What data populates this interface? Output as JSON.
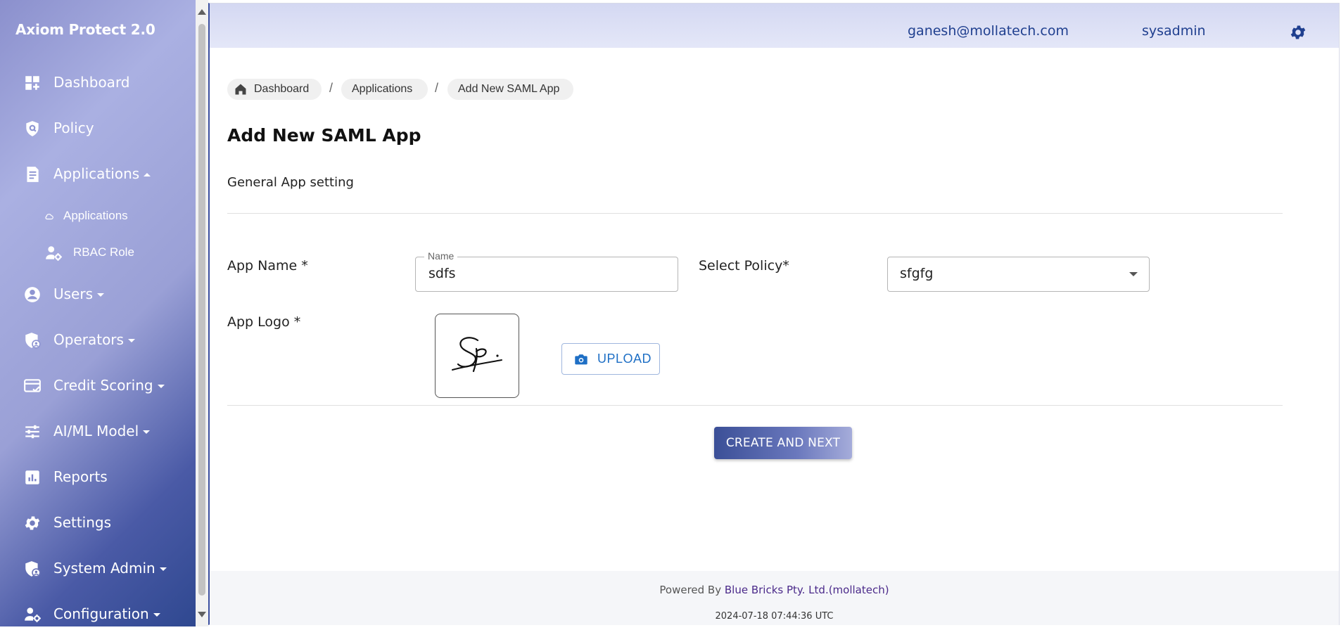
{
  "app": {
    "brand": "Axiom Protect 2.0"
  },
  "sidebar": {
    "items": [
      {
        "label": "Dashboard",
        "icon": "dashboard-icon"
      },
      {
        "label": "Policy",
        "icon": "shield-search-icon"
      },
      {
        "label": "Applications",
        "icon": "document-icon",
        "expanded": true
      },
      {
        "label": "Users",
        "icon": "user-circle-icon"
      },
      {
        "label": "Operators",
        "icon": "shield-person-icon"
      },
      {
        "label": "Credit Scoring",
        "icon": "card-check-icon"
      },
      {
        "label": "AI/ML Model",
        "icon": "sliders-icon"
      },
      {
        "label": "Reports",
        "icon": "bar-chart-icon"
      },
      {
        "label": "Settings",
        "icon": "gear-icon"
      },
      {
        "label": "System Admin",
        "icon": "shield-lock-icon"
      },
      {
        "label": "Configuration",
        "icon": "user-gear-icon"
      }
    ],
    "subitems": [
      {
        "label": "Applications",
        "icon": "cloud-icon"
      },
      {
        "label": "RBAC Role",
        "icon": "user-gear-icon"
      }
    ]
  },
  "header": {
    "email": "ganesh@mollatech.com",
    "role": "sysadmin",
    "settings_icon": "gear-icon"
  },
  "breadcrumb": {
    "items": [
      "Dashboard",
      "Applications",
      "Add New SAML App"
    ],
    "separator": "/",
    "home_icon": "home-icon"
  },
  "page": {
    "title": "Add New SAML App",
    "section": "General App setting"
  },
  "form": {
    "app_name_label": "App Name *",
    "app_name_field_label": "Name",
    "app_name_value": "sdfs",
    "policy_label": "Select Policy*",
    "policy_value": "sfgfg",
    "logo_label": "App Logo *",
    "upload_label": "UPLOAD",
    "upload_icon": "camera-icon",
    "submit_label": "CREATE AND NEXT"
  },
  "footer": {
    "powered_prefix": "Powered By ",
    "company": "Blue Bricks Pty. Ltd.(mollatech)",
    "timestamp": "2024-07-18 07:44:36 UTC"
  },
  "colors": {
    "accent": "#1f3f8f",
    "upload": "#1e6fc5",
    "company": "#4b2a8a"
  }
}
